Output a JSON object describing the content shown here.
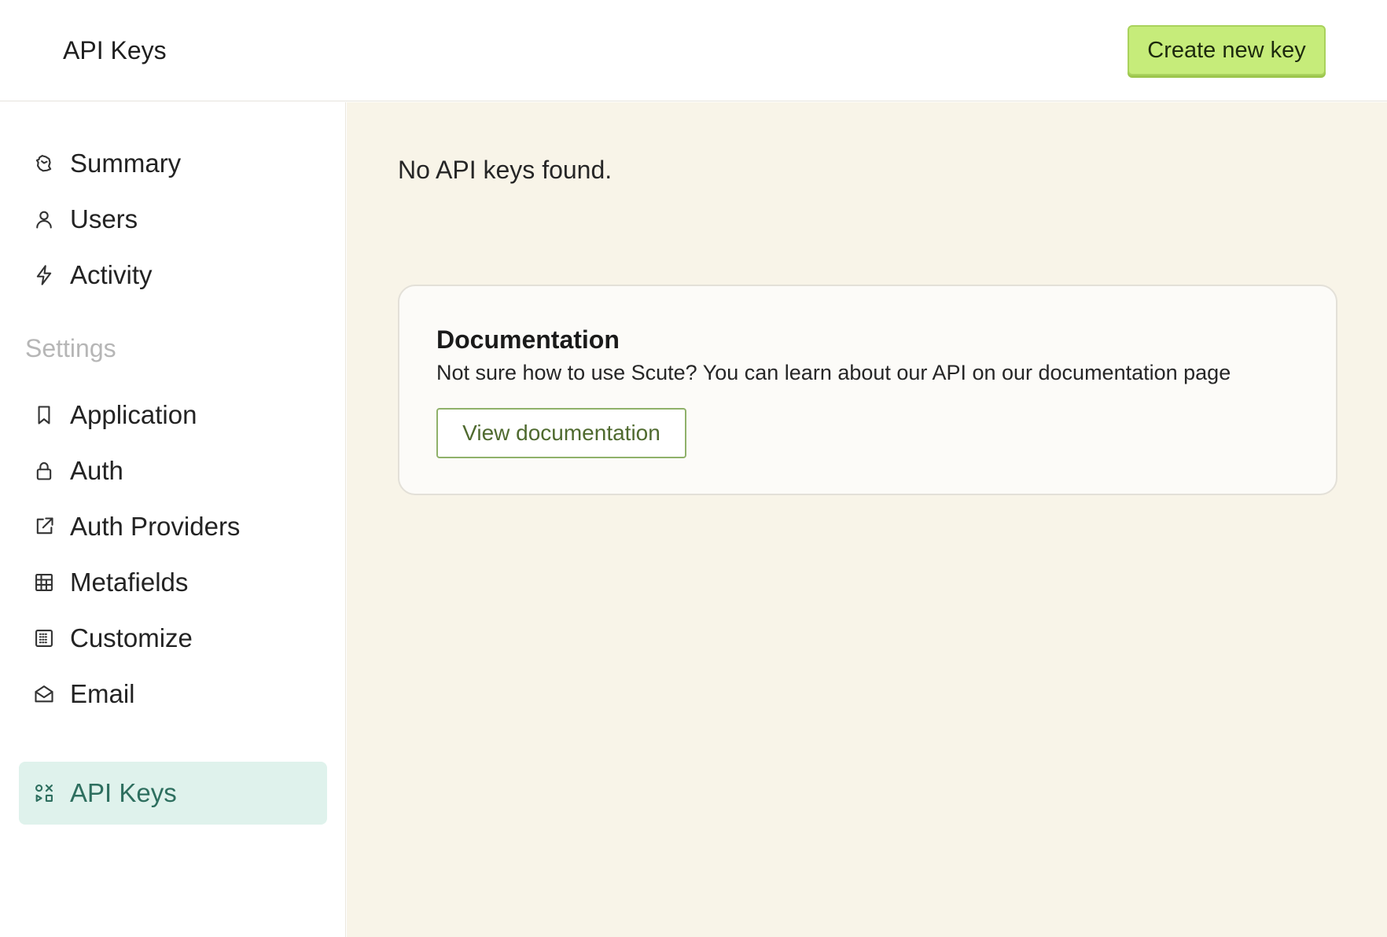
{
  "header": {
    "title": "API Keys",
    "create_button_label": "Create new key"
  },
  "sidebar": {
    "items": [
      {
        "label": "Summary",
        "icon": "summary-icon"
      },
      {
        "label": "Users",
        "icon": "user-icon"
      },
      {
        "label": "Activity",
        "icon": "lightning-icon"
      }
    ],
    "settings_label": "Settings",
    "settings_items": [
      {
        "label": "Application",
        "icon": "bookmark-icon"
      },
      {
        "label": "Auth",
        "icon": "lock-icon"
      },
      {
        "label": "Auth Providers",
        "icon": "external-link-icon"
      },
      {
        "label": "Metafields",
        "icon": "table-icon"
      },
      {
        "label": "Customize",
        "icon": "dotted-square-icon"
      },
      {
        "label": "Email",
        "icon": "envelope-open-icon"
      },
      {
        "label": "API Keys",
        "icon": "api-keys-icon",
        "active": true
      }
    ]
  },
  "main": {
    "empty_message": "No API keys found.",
    "doc_card": {
      "title": "Documentation",
      "text": "Not sure how to use Scute? You can learn about our API on our documentation page",
      "button_label": "View documentation"
    }
  },
  "colors": {
    "accent_button": "#c6ec7a",
    "active_nav_bg": "#dff2ec",
    "active_nav_text": "#2e6f5f",
    "main_bg": "#f8f4e8"
  }
}
